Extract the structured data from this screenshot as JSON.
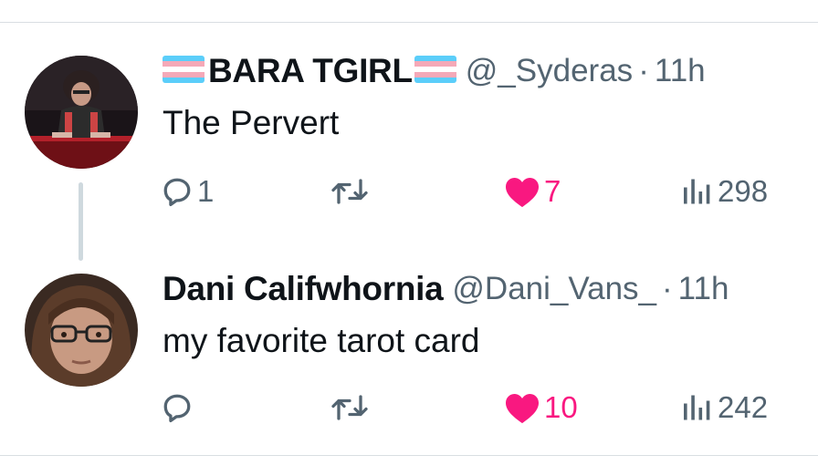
{
  "tweets": [
    {
      "display_name": "BARA TGIRL",
      "name_flags": "transgender-flag-emoji",
      "handle": "@_Syderas",
      "separator": "·",
      "time": "11h",
      "text": "The Pervert",
      "replies": "1",
      "retweets": "",
      "likes": "7",
      "liked": true,
      "views": "298"
    },
    {
      "display_name": "Dani Califwhornia",
      "handle": "@Dani_Vans_",
      "separator": "·",
      "time": "11h",
      "text": "my favorite tarot card",
      "replies": "",
      "retweets": "",
      "likes": "10",
      "liked": true,
      "views": "242"
    }
  ],
  "colors": {
    "text_primary": "#0f1419",
    "text_secondary": "#536471",
    "like_active": "#f91880",
    "divider": "#d9dee2",
    "thread_line": "#cfd9de"
  },
  "icons": [
    "reply-icon",
    "retweet-icon",
    "like-heart-icon",
    "views-icon",
    "transgender-flag-emoji"
  ]
}
